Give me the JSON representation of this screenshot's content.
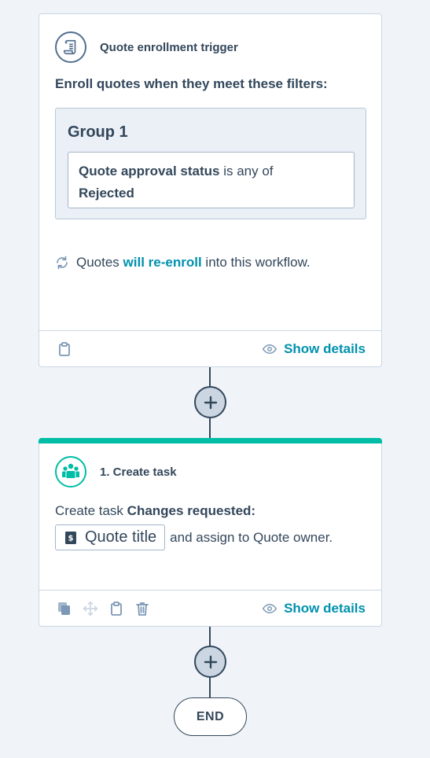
{
  "trigger": {
    "title": "Quote enrollment trigger",
    "filters_label": "Enroll quotes when they meet these filters:",
    "group": {
      "title": "Group 1",
      "filter": {
        "property": "Quote approval status",
        "operator": "is any of",
        "value": "Rejected"
      }
    },
    "reenroll": {
      "prefix": "Quotes",
      "emphasis": "will re-enroll",
      "suffix": "into this workflow."
    },
    "footer": {
      "show_details": "Show details"
    }
  },
  "action": {
    "title": "1. Create task",
    "text_prefix": "Create task",
    "task_name": "Changes requested:",
    "token_label": "Quote title",
    "assign_text": "and assign to Quote owner.",
    "footer": {
      "show_details": "Show details"
    }
  },
  "end_label": "END",
  "colors": {
    "accent": "#0091ae",
    "action_bar": "#00bda5",
    "text": "#33475b",
    "background": "#f0f4f9"
  },
  "icons": {
    "trigger": "scroll-icon",
    "action": "people-icon",
    "reenroll": "refresh-icon",
    "details": "eye-icon",
    "token": "quote-icon"
  }
}
